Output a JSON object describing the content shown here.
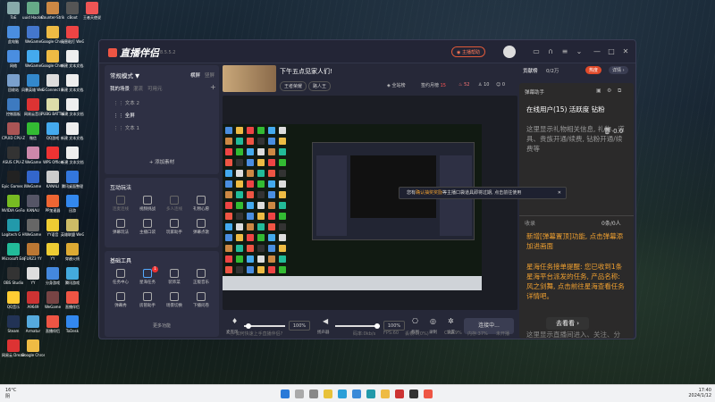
{
  "desktop": {
    "icons": [
      {
        "label": "ToE",
        "color": "#8aa"
      },
      {
        "label": "uuid Hacker",
        "color": "#6a8"
      },
      {
        "label": "Counter-Strike",
        "color": "#c84"
      },
      {
        "label": "cBoot",
        "color": "#555"
      },
      {
        "label": "王者天使说",
        "color": "#e55"
      },
      {
        "label": "此电脑",
        "color": "#4a8ee0"
      },
      {
        "label": "WeGame",
        "color": "#47c"
      },
      {
        "label": "Google Chrome",
        "color": "#eb4"
      },
      {
        "label": "无害粘打 WeGame",
        "color": "#e44"
      },
      {
        "label": "网络",
        "color": "#4a8ee0"
      },
      {
        "label": "WeGame",
        "color": "#4ae"
      },
      {
        "label": "Google Chrome",
        "color": "#eb4"
      },
      {
        "label": "新建 文本文档.txt",
        "color": "#eee"
      },
      {
        "label": "回收站",
        "color": "#7aa0cc"
      },
      {
        "label": "风暴英雄 WeGame",
        "color": "#38c"
      },
      {
        "label": "L-Connect 3",
        "color": "#ddd"
      },
      {
        "label": "新建 文本文档.txt",
        "color": "#eee"
      },
      {
        "label": "控制面板",
        "color": "#3d7ac0"
      },
      {
        "label": "网易云音乐",
        "color": "#d33"
      },
      {
        "label": "PUBG BATTLEGR...",
        "color": "#dda"
      },
      {
        "label": "新建 文本文档",
        "color": "#eee"
      },
      {
        "label": "CPUID CPU-Z",
        "color": "#a55"
      },
      {
        "label": "微信",
        "color": "#3b3"
      },
      {
        "label": "QQ游戏",
        "color": "#4ae"
      },
      {
        "label": "新建 文本文档.txt",
        "color": "#eee"
      },
      {
        "label": "ASUS CPU-Z",
        "color": "#333"
      },
      {
        "label": "WeGame",
        "color": "#c8a"
      },
      {
        "label": "WPS Office",
        "color": "#e33"
      },
      {
        "label": "新建 文本文档",
        "color": "#eee"
      },
      {
        "label": "Epic Games Launcher",
        "color": "#222"
      },
      {
        "label": "WeGame",
        "color": "#36c"
      },
      {
        "label": "KANALI",
        "color": "#ccc"
      },
      {
        "label": "腾讯桌面整理",
        "color": "#37d"
      },
      {
        "label": "NVIDIA GeForce Ex...",
        "color": "#7b2"
      },
      {
        "label": "KANAU",
        "color": "#556"
      },
      {
        "label": "PP加速器",
        "color": "#e63"
      },
      {
        "label": "迅游",
        "color": "#38e"
      },
      {
        "label": "Logitech G HUB",
        "color": "#29a"
      },
      {
        "label": "WeGame",
        "color": "#666"
      },
      {
        "label": "YY语音",
        "color": "#ec3"
      },
      {
        "label": "英雄联盟 WeGame",
        "color": "#cb6"
      },
      {
        "label": "Microsoft Edge",
        "color": "#2b9"
      },
      {
        "label": "FURZ3 YY",
        "color": "#b73"
      },
      {
        "label": "YY",
        "color": "#ec3"
      },
      {
        "label": "穿越火线",
        "color": "#da3"
      },
      {
        "label": "OBS Studio",
        "color": "#333"
      },
      {
        "label": "YY",
        "color": "#ddd"
      },
      {
        "label": "分身游戏",
        "color": "#48d"
      },
      {
        "label": "腾讯游戏",
        "color": "#4ad"
      },
      {
        "label": "QQ音乐",
        "color": "#fc3"
      },
      {
        "label": "A9649",
        "color": "#c33"
      },
      {
        "label": "WeGame",
        "color": "#744"
      },
      {
        "label": "直播伴侣",
        "color": "#e54"
      },
      {
        "label": "Steam",
        "color": "#235"
      },
      {
        "label": "Armatur",
        "color": "#5ad"
      },
      {
        "label": "直播伴侣",
        "color": "#e54"
      },
      {
        "label": "ToDesk",
        "color": "#38e"
      },
      {
        "label": "网易云 DreamBD",
        "color": "#d33"
      },
      {
        "label": "Google Chrome",
        "color": "#eb4"
      }
    ]
  },
  "app": {
    "name": "直播伴侣",
    "version": "8.5.5.2",
    "help_label": "主播帮助",
    "window_controls": [
      "chat-icon",
      "headset-icon",
      "menu-icon",
      "minimize-icon",
      "maximize-icon",
      "close-icon"
    ]
  },
  "left": {
    "mode_label": "常规模式 ▼",
    "orient_landscape": "横屏",
    "orient_portrait": "竖屏",
    "scene_tabs": [
      "我的场景",
      "混流",
      "可用元"
    ],
    "scene_items": [
      "文本 2",
      "全屏",
      "文本 1"
    ],
    "add_source": "添加素材",
    "interact_title": "互动玩法",
    "interact_tools": [
      "连麦连线",
      "视频挑战",
      "多人连线",
      "礼物心愿",
      "弹幕玩法",
      "主播口袋",
      "玩家助手",
      "弹幕点歌"
    ],
    "basic_title": "基础工具",
    "basic_tools": [
      "任务中心",
      "星海任务",
      "装饰菜",
      "正版音乐",
      "弹幕秀",
      "房管助手",
      "场景切换",
      "下播问卷"
    ],
    "star_badge": "1",
    "more_label": "更多功能"
  },
  "stream": {
    "title": "下午五点见家人们!",
    "tags": [
      "王者荣耀",
      "路人王"
    ],
    "all_label": "全站榜",
    "fans_label": "签约月榜",
    "fans_value": "15",
    "stat1": "52",
    "stat2": "10",
    "stat3": "0"
  },
  "controls": {
    "mic_label": "麦克风",
    "mic_value": "100%",
    "speaker_label": "扬声器",
    "speaker_value": "100%",
    "screenshot_label": "截图",
    "record_label": "录制",
    "settings_label": "设置",
    "live_button": "连接中..."
  },
  "notice": {
    "text_a": "您有",
    "link": "确认抽奖奖励",
    "text_b": "等主播口袋道具即将过期, 点击前往使用"
  },
  "statusbar": {
    "left": "如何快速上手直播伴侣?",
    "bitrate": "码率:0kb/s",
    "fps": "FPS:60",
    "dropped": "丢帧:0(0%)",
    "cpu": "CPU:9%",
    "memory": "内存:37%",
    "tail": "未开播"
  },
  "right": {
    "tab_contrib": "贡献榜",
    "count": "0/2万",
    "hot": "热度",
    "detail": "详情 ›",
    "assistant_title": "弹幕助手",
    "online": "在线用户(15) 活跃度 钻粉",
    "placeholder": "这里显示礼物相关信息, 礼物、道具、贵族开通/续费, 钻粉开通/续费等",
    "score": "0.0",
    "msg_tab": "收录",
    "msg_count": "0条/0人",
    "new_feature": "新增[弹幕置顶]功能, 点击弹幕添加进画面",
    "task_notice": "星海任务接单提醒: 您已收到1条星海平台派发的任务, 产品名称: 风之剑舞, 点击前往星海查看任务详情吧。",
    "go_view": "去看看 ›",
    "footer": "这里显示直播间进入、关注、分享等进场用户的消息"
  },
  "taskbar": {
    "weather": "阴",
    "temp": "16°C",
    "time": "17:40",
    "date": "2024/1/12"
  }
}
